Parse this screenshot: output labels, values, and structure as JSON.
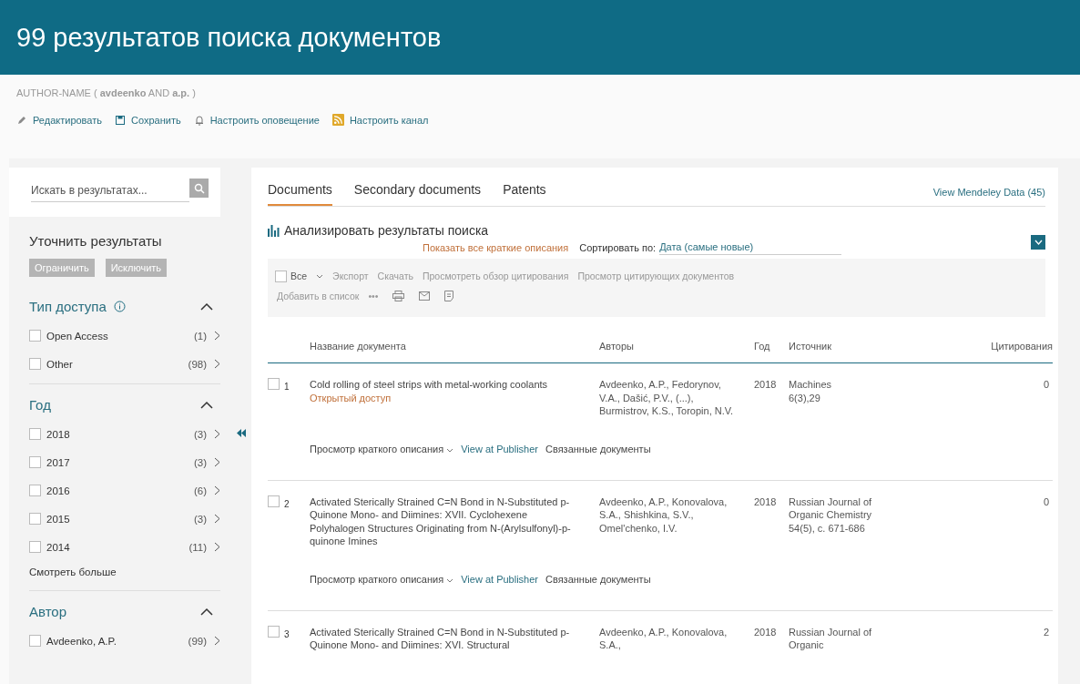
{
  "header": {
    "title": "99 результатов поиска документов"
  },
  "query": "AUTHOR-NAME ( **avdeenko**  AND **a.p.** )",
  "actions": [
    {
      "kind": "edit",
      "label": "Редактировать"
    },
    {
      "kind": "save",
      "label": "Сохранить"
    },
    {
      "kind": "alert",
      "label": "Настроить оповещение"
    },
    {
      "kind": "feed",
      "label": "Настроить канал"
    }
  ],
  "sidebar": {
    "search": {
      "placeholder": "Искать в результатах..."
    },
    "refine_title": "Уточнить результаты",
    "buttons": [
      "Ограничить",
      "Исключить"
    ],
    "facets": [
      {
        "title": "Тип доступа",
        "info": true,
        "expanded": true,
        "items": [
          {
            "label": "Open Access",
            "count": "(1)",
            "checked": false
          },
          {
            "label": "Other",
            "count": "(98)",
            "checked": false
          }
        ]
      },
      {
        "title": "Год",
        "info": false,
        "expanded": true,
        "items": [
          {
            "label": "2018",
            "count": "(3)",
            "checked": false
          },
          {
            "label": "2017",
            "count": "(3)",
            "checked": false
          },
          {
            "label": "2016",
            "count": "(6)",
            "checked": false
          },
          {
            "label": "2015",
            "count": "(3)",
            "checked": false
          },
          {
            "label": "2014",
            "count": "(11)",
            "checked": false
          }
        ],
        "more": "Смотреть больше"
      },
      {
        "title": "Автор",
        "info": false,
        "expanded": true,
        "items": [
          {
            "label": "Avdeenko, A.P.",
            "count": "(99)",
            "checked": false
          }
        ]
      }
    ]
  },
  "results": {
    "tabs": [
      {
        "label": "Documents",
        "selected": true
      },
      {
        "label": "Secondary documents",
        "selected": false
      },
      {
        "label": "Patents",
        "selected": false
      }
    ],
    "mendeley": "View Mendeley Data (45)",
    "analyze": "Анализировать результаты поиска",
    "show_all": "Показать все краткие описания",
    "sort_label": "Сортировать по:",
    "sort_value": "Дата (самые новые)",
    "select_all": {
      "label": "Все",
      "checked": false
    },
    "toolbar": [
      "Экспорт",
      "Скачать",
      "Просмотреть обзор цитирования",
      "Просмотр цитирующих документов"
    ],
    "add_to_list": "Добавить в список",
    "more": "•••",
    "columns": [
      "Название документа",
      "Авторы",
      "Год",
      "Источник",
      "Цитирования"
    ],
    "rows": [
      {
        "number": "1",
        "checked": false,
        "title": "Cold rolling of steel strips with metal-working coolants",
        "open_access": "Открытый доступ",
        "authors": "Avdeenko, A.P., Fedorynov, V.A., Dašić, P.V., (...), Burmistrov, K.S., Toropin, N.V.",
        "year": "2018",
        "source": [
          "Machines",
          "6(3),29"
        ],
        "citations": "0",
        "links": [
          "Просмотр краткого описания",
          "View at Publisher",
          "Связанные документы"
        ]
      },
      {
        "number": "2",
        "checked": false,
        "title": "Activated Sterically Strained C=N Bond in N-Substituted p-Quinone Mono- and Diimines: XVII. Cyclohexene Polyhalogen Structures Originating from N-(Arylsulfonyl)-p-quinone Imines",
        "authors": "Avdeenko, A.P., Konovalova, S.A., Shishkina, S.V., Omel'chenko, I.V.",
        "year": "2018",
        "source": [
          "Russian Journal of Organic Chemistry",
          "54(5), с. 671-686"
        ],
        "citations": "0",
        "links": [
          "Просмотр краткого описания",
          "View at Publisher",
          "Связанные документы"
        ]
      },
      {
        "number": "3",
        "checked": false,
        "title": "Activated Sterically Strained C=N Bond in N-Substituted p-Quinone Mono- and Diimines: XVI. Structural",
        "authors": "Avdeenko, A.P., Konovalova, S.A.,",
        "year": "2018",
        "source": [
          "Russian Journal of Organic"
        ],
        "citations": "2"
      }
    ]
  }
}
